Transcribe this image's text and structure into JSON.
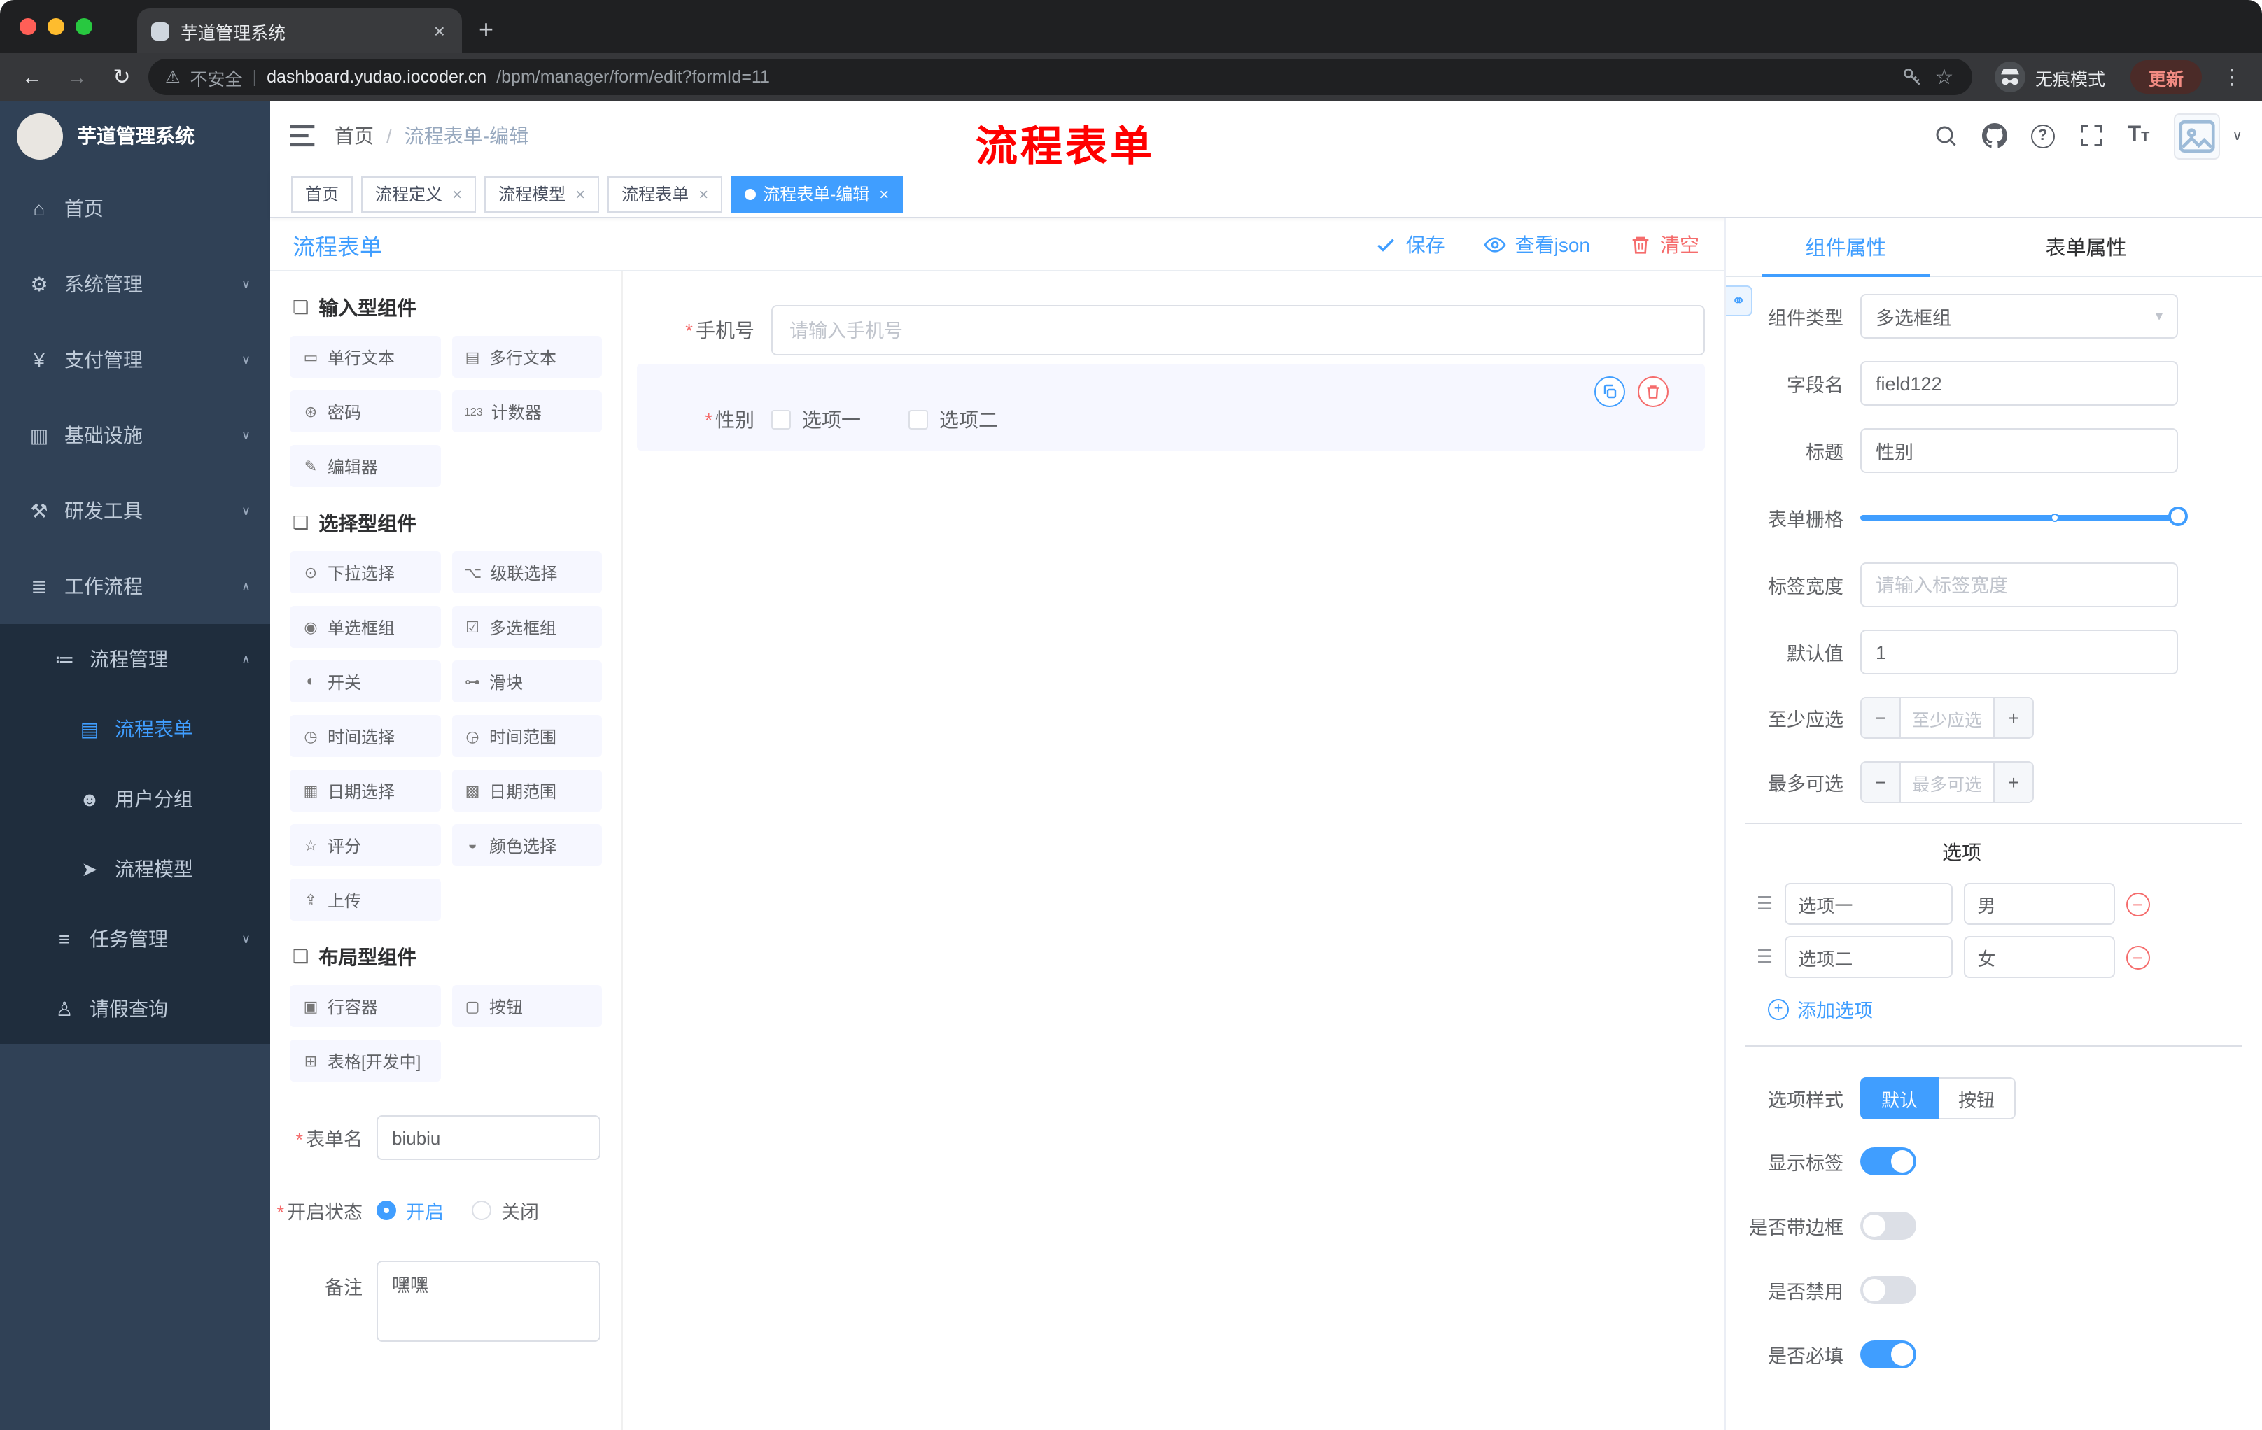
{
  "ui": {
    "required_mark": "*"
  },
  "colors": {
    "accent": "#409eff",
    "danger": "#f56c6c",
    "annotation_red": "#ff0000",
    "sidebar_bg": "#304156",
    "submenu_bg": "#1f2d3d",
    "active_tag_bg": "#409eff"
  },
  "browser": {
    "tab_title": "芋道管理系统",
    "security_label": "不安全",
    "url_separator": "|",
    "url_domain": "dashboard.yudao.iocoder.cn",
    "url_path": "/bpm/manager/form/edit?formId=11",
    "incognito_label": "无痕模式",
    "update_label": "更新"
  },
  "sidebar": {
    "app_title": "芋道管理系统",
    "items": [
      {
        "label": "首页",
        "icon": "⌂"
      },
      {
        "label": "系统管理",
        "icon": "⚙"
      },
      {
        "label": "支付管理",
        "icon": "¥"
      },
      {
        "label": "基础设施",
        "icon": "▥"
      },
      {
        "label": "研发工具",
        "icon": "⚒"
      },
      {
        "label": "工作流程",
        "icon": "≣"
      },
      {
        "label": "流程管理",
        "icon": "≔"
      },
      {
        "label": "流程表单",
        "icon": "▤"
      },
      {
        "label": "用户分组",
        "icon": "☻"
      },
      {
        "label": "流程模型",
        "icon": "➤"
      },
      {
        "label": "任务管理",
        "icon": "≡"
      },
      {
        "label": "请假查询",
        "icon": "♙"
      }
    ]
  },
  "header": {
    "breadcrumb_home": "首页",
    "breadcrumb_sep": "/",
    "breadcrumb_current": "流程表单-编辑",
    "annotation_title": "流程表单"
  },
  "tags": [
    {
      "label": "首页"
    },
    {
      "label": "流程定义"
    },
    {
      "label": "流程模型"
    },
    {
      "label": "流程表单"
    },
    {
      "label": "流程表单-编辑"
    }
  ],
  "designer": {
    "title": "流程表单",
    "save_label": "保存",
    "view_json_label": "查看json",
    "clear_label": "清空"
  },
  "palette": {
    "sections": [
      {
        "title": "输入型组件",
        "items": [
          {
            "label": "单行文本",
            "icon": "▭"
          },
          {
            "label": "多行文本",
            "icon": "▤"
          },
          {
            "label": "密码",
            "icon": "⊛"
          },
          {
            "label": "计数器",
            "icon": "123"
          },
          {
            "label": "编辑器",
            "icon": "✎"
          }
        ]
      },
      {
        "title": "选择型组件",
        "items": [
          {
            "label": "下拉选择",
            "icon": "⊙"
          },
          {
            "label": "级联选择",
            "icon": "⌥"
          },
          {
            "label": "单选框组",
            "icon": "◉"
          },
          {
            "label": "多选框组",
            "icon": "☑"
          },
          {
            "label": "开关",
            "icon": "◐"
          },
          {
            "label": "滑块",
            "icon": "⊶"
          },
          {
            "label": "时间选择",
            "icon": "◷"
          },
          {
            "label": "时间范围",
            "icon": "◶"
          },
          {
            "label": "日期选择",
            "icon": "▦"
          },
          {
            "label": "日期范围",
            "icon": "▩"
          },
          {
            "label": "评分",
            "icon": "☆"
          },
          {
            "label": "颜色选择",
            "icon": "◒"
          },
          {
            "label": "上传",
            "icon": "⇪"
          }
        ]
      },
      {
        "title": "布局型组件",
        "items": [
          {
            "label": "行容器",
            "icon": "▣"
          },
          {
            "label": "按钮",
            "icon": "▢"
          },
          {
            "label": "表格[开发中]",
            "icon": "⊞"
          }
        ]
      }
    ],
    "form": {
      "name_label": "表单名",
      "name_value": "biubiu",
      "status_label": "开启状态",
      "status_on": "开启",
      "status_off": "关闭",
      "remark_label": "备注",
      "remark_value": "嘿嘿"
    }
  },
  "canvas": {
    "phone_label": "手机号",
    "phone_placeholder": "请输入手机号",
    "gender_label": "性别",
    "gender_options": [
      "选项一",
      "选项二"
    ]
  },
  "props": {
    "tab_component": "组件属性",
    "tab_form": "表单属性",
    "component_type_label": "组件类型",
    "component_type_value": "多选框组",
    "field_name_label": "字段名",
    "field_name_value": "field122",
    "title_label": "标题",
    "title_value": "性别",
    "grid_label": "表单栅格",
    "label_width_label": "标签宽度",
    "label_width_placeholder": "请输入标签宽度",
    "default_label": "默认值",
    "default_value": "1",
    "min_label": "至少应选",
    "min_placeholder": "至少应选",
    "max_label": "最多可选",
    "max_placeholder": "最多可选",
    "options_title": "选项",
    "options": [
      {
        "name": "选项一",
        "value": "男"
      },
      {
        "name": "选项二",
        "value": "女"
      }
    ],
    "add_option_label": "添加选项",
    "option_style_label": "选项样式",
    "style_default": "默认",
    "style_button": "按钮",
    "switch_show_label": "显示标签",
    "switch_border": "是否带边框",
    "switch_disabled": "是否禁用",
    "switch_required": "是否必填"
  }
}
